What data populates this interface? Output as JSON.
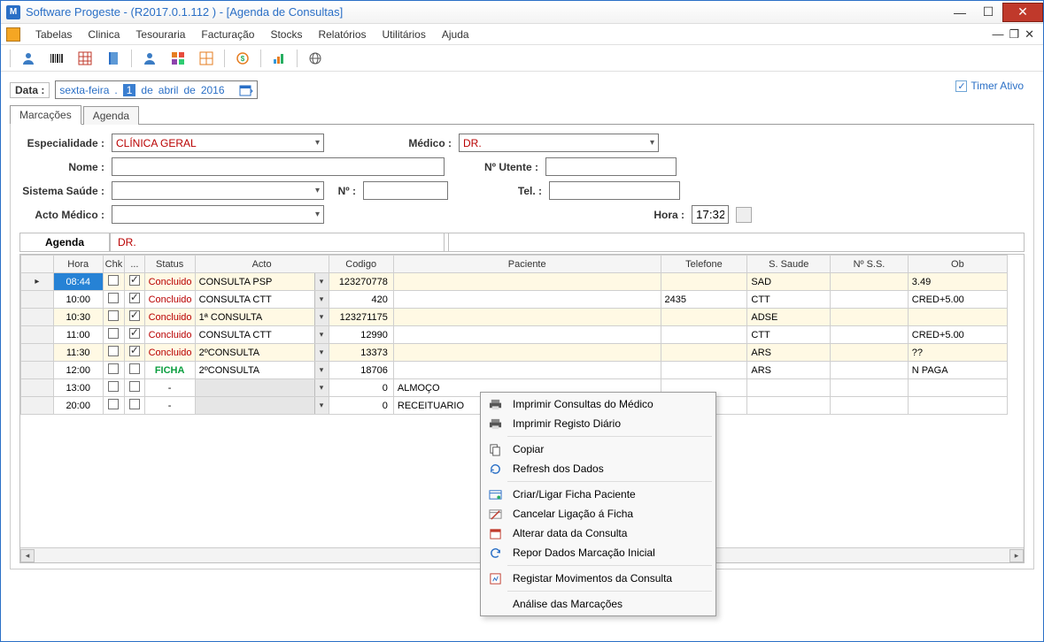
{
  "window": {
    "title": "Software Progeste - (R2017.0.1.112 ) - [Agenda de Consultas]"
  },
  "menubar": [
    "Tabelas",
    "Clinica",
    "Tesouraria",
    "Facturação",
    "Stocks",
    "Relatórios",
    "Utilitários",
    "Ajuda"
  ],
  "date": {
    "label": "Data :",
    "dow_prefix": "sexta-feira",
    "sep": ".",
    "day": "1",
    "de1": "de",
    "month": "abril",
    "de2": "de",
    "year": "2016"
  },
  "timer_checkbox": {
    "label": "Timer Ativo",
    "checked": true
  },
  "tabs": [
    "Marcações",
    "Agenda"
  ],
  "form": {
    "especialidade_label": "Especialidade :",
    "especialidade_value": "CLÍNICA GERAL",
    "medico_label": "Médico :",
    "medico_value": "DR.",
    "nome_label": "Nome :",
    "nome_value": "",
    "utente_label": "Nº Utente :",
    "utente_value": "",
    "sistema_label": "Sistema Saúde :",
    "sistema_value": "",
    "num_label": "Nº :",
    "num_value": "",
    "tel_label": "Tel. :",
    "tel_value": "",
    "acto_label": "Acto Médico :",
    "acto_value": "",
    "hora_label": "Hora :",
    "hora_value": "17:32"
  },
  "agenda_title": "Agenda",
  "agenda_medico": "DR.",
  "grid": {
    "headers": [
      "",
      "Hora",
      "Chk",
      "...",
      "Status",
      "Acto",
      "Codigo",
      "Paciente",
      "Telefone",
      "S. Saude",
      "Nº S.S.",
      "Ob"
    ],
    "rows": [
      {
        "indicator": "▸",
        "hora": "08:44",
        "chk": false,
        "dots": true,
        "status": "Concluido",
        "status_type": "concluido",
        "acto": "CONSULTA PSP",
        "codigo": "123270778",
        "paciente": "",
        "telefone": "",
        "saude": "SAD",
        "ss": "",
        "ob": "3.49",
        "tone": "yellow",
        "selected": true
      },
      {
        "indicator": "",
        "hora": "10:00",
        "chk": false,
        "dots": true,
        "status": "Concluido",
        "status_type": "concluido",
        "acto": "CONSULTA CTT",
        "codigo": "420",
        "paciente": "",
        "telefone": "2435",
        "saude": "CTT",
        "ss": "",
        "ob": "CRED+5.00",
        "tone": "white"
      },
      {
        "indicator": "",
        "hora": "10:30",
        "chk": false,
        "dots": true,
        "status": "Concluido",
        "status_type": "concluido",
        "acto": "1ª CONSULTA",
        "codigo": "123271175",
        "paciente": "",
        "telefone": "",
        "saude": "ADSE",
        "ss": "",
        "ob": "",
        "tone": "yellow"
      },
      {
        "indicator": "",
        "hora": "11:00",
        "chk": false,
        "dots": true,
        "status": "Concluido",
        "status_type": "concluido",
        "acto": "CONSULTA CTT",
        "codigo": "12990",
        "paciente": "",
        "telefone": "",
        "saude": "CTT",
        "ss": "",
        "ob": "CRED+5.00",
        "tone": "white"
      },
      {
        "indicator": "",
        "hora": "11:30",
        "chk": false,
        "dots": true,
        "status": "Concluido",
        "status_type": "concluido",
        "acto": "2ºCONSULTA",
        "codigo": "13373",
        "paciente": "",
        "telefone": "",
        "saude": "ARS",
        "ss": "",
        "ob": "??",
        "tone": "yellow"
      },
      {
        "indicator": "",
        "hora": "12:00",
        "chk": false,
        "dots": false,
        "status": "FICHA",
        "status_type": "ficha",
        "acto": "2ºCONSULTA",
        "codigo": "18706",
        "paciente": "",
        "telefone": "",
        "saude": "ARS",
        "ss": "",
        "ob": "N PAGA",
        "tone": "white"
      },
      {
        "indicator": "",
        "hora": "13:00",
        "chk": false,
        "dots": false,
        "status": "-",
        "status_type": "none",
        "acto": "",
        "codigo": "0",
        "paciente": "ALMOÇO",
        "telefone": "",
        "saude": "",
        "ss": "",
        "ob": "",
        "tone": "white"
      },
      {
        "indicator": "",
        "hora": "20:00",
        "chk": false,
        "dots": false,
        "status": "-",
        "status_type": "none",
        "acto": "",
        "codigo": "0",
        "paciente": "RECEITUARIO",
        "telefone": "",
        "saude": "",
        "ss": "",
        "ob": "",
        "tone": "white"
      }
    ]
  },
  "context_menu": [
    {
      "type": "item",
      "label": "Imprimir Consultas do Médico",
      "icon": "printer"
    },
    {
      "type": "item",
      "label": "Imprimir Registo Diário",
      "icon": "printer"
    },
    {
      "type": "sep"
    },
    {
      "type": "item",
      "label": "Copiar",
      "icon": "copy"
    },
    {
      "type": "item",
      "label": "Refresh dos Dados",
      "icon": "refresh"
    },
    {
      "type": "sep"
    },
    {
      "type": "item",
      "label": "Criar/Ligar Ficha Paciente",
      "icon": "link"
    },
    {
      "type": "item",
      "label": "Cancelar Ligação á Ficha",
      "icon": "unlink"
    },
    {
      "type": "item",
      "label": "Alterar data da Consulta",
      "icon": "calendar"
    },
    {
      "type": "item",
      "label": "Repor Dados Marcação Inicial",
      "icon": "undo"
    },
    {
      "type": "sep"
    },
    {
      "type": "item",
      "label": "Registar Movimentos da Consulta",
      "icon": "register"
    },
    {
      "type": "sep"
    },
    {
      "type": "item",
      "label": "Análise das Marcações",
      "icon": "none"
    }
  ]
}
